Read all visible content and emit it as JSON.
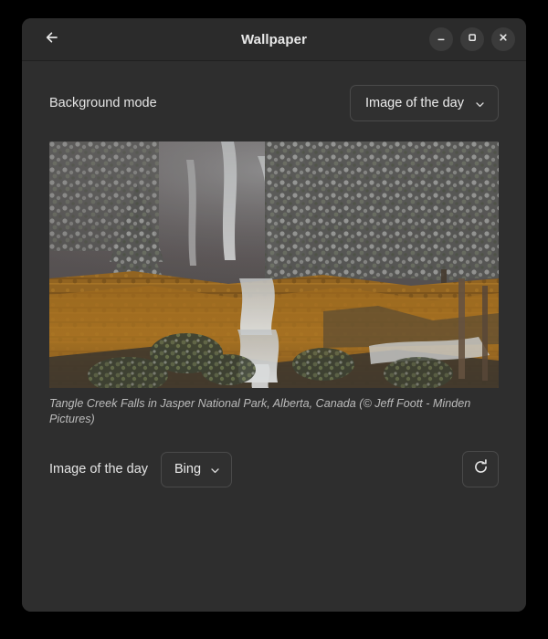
{
  "window": {
    "title": "Wallpaper",
    "back_icon": "arrow-left-icon",
    "controls": {
      "minimize_label": "–",
      "maximize_label": "□",
      "close_label": "×"
    }
  },
  "background_mode": {
    "label": "Background mode",
    "selected": "Image of the day",
    "chevron_icon": "chevron-down-icon"
  },
  "preview": {
    "caption": "Tangle Creek Falls in Jasper National Park, Alberta, Canada (© Jeff Foott - Minden Pictures)",
    "alt": "Snow-dusted evergreen forest above ochre cliffs with cascading waterfalls"
  },
  "image_of_the_day": {
    "label": "Image of the day",
    "provider": "Bing",
    "chevron_icon": "chevron-down-icon",
    "refresh_icon": "refresh-icon"
  },
  "colors": {
    "window_bg": "#2e2e2e",
    "titlebar_bg": "#2b2b2b",
    "control_bg": "#3b3b3b",
    "border": "#4a4a4a",
    "text": "#e8e8e8",
    "caption_text": "#bcbcbc",
    "desktop_bg": "#000000"
  }
}
